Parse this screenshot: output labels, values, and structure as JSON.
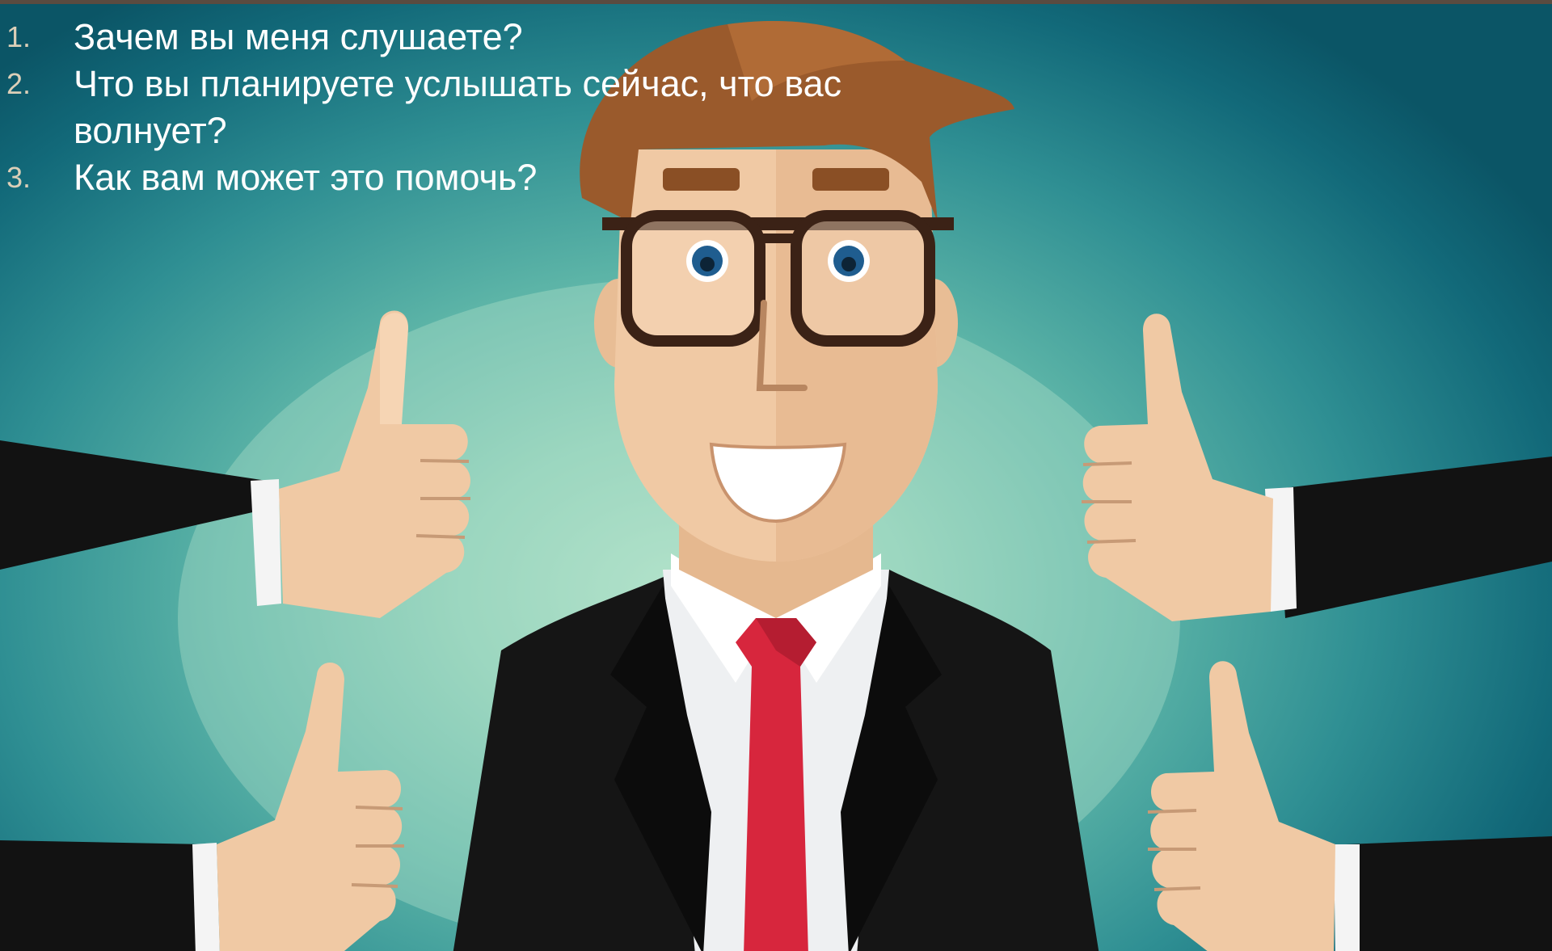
{
  "slide": {
    "questions": [
      {
        "number": "1.",
        "text": "Зачем вы меня слушаете?"
      },
      {
        "number": "2.",
        "text": "Что вы планируете услышать сейчас, что вас волнует?"
      },
      {
        "number": "3.",
        "text": "Как вам может это помочь?"
      }
    ]
  },
  "colors": {
    "background_center": "#aee0c8",
    "background_edge": "#0b5566",
    "text": "#ffffff",
    "number_text": "#dccfb8",
    "suit": "#141414",
    "tie": "#d7263d",
    "skin": "#f0c9a4",
    "hair": "#9a5a2c",
    "glasses": "#3b2216"
  }
}
